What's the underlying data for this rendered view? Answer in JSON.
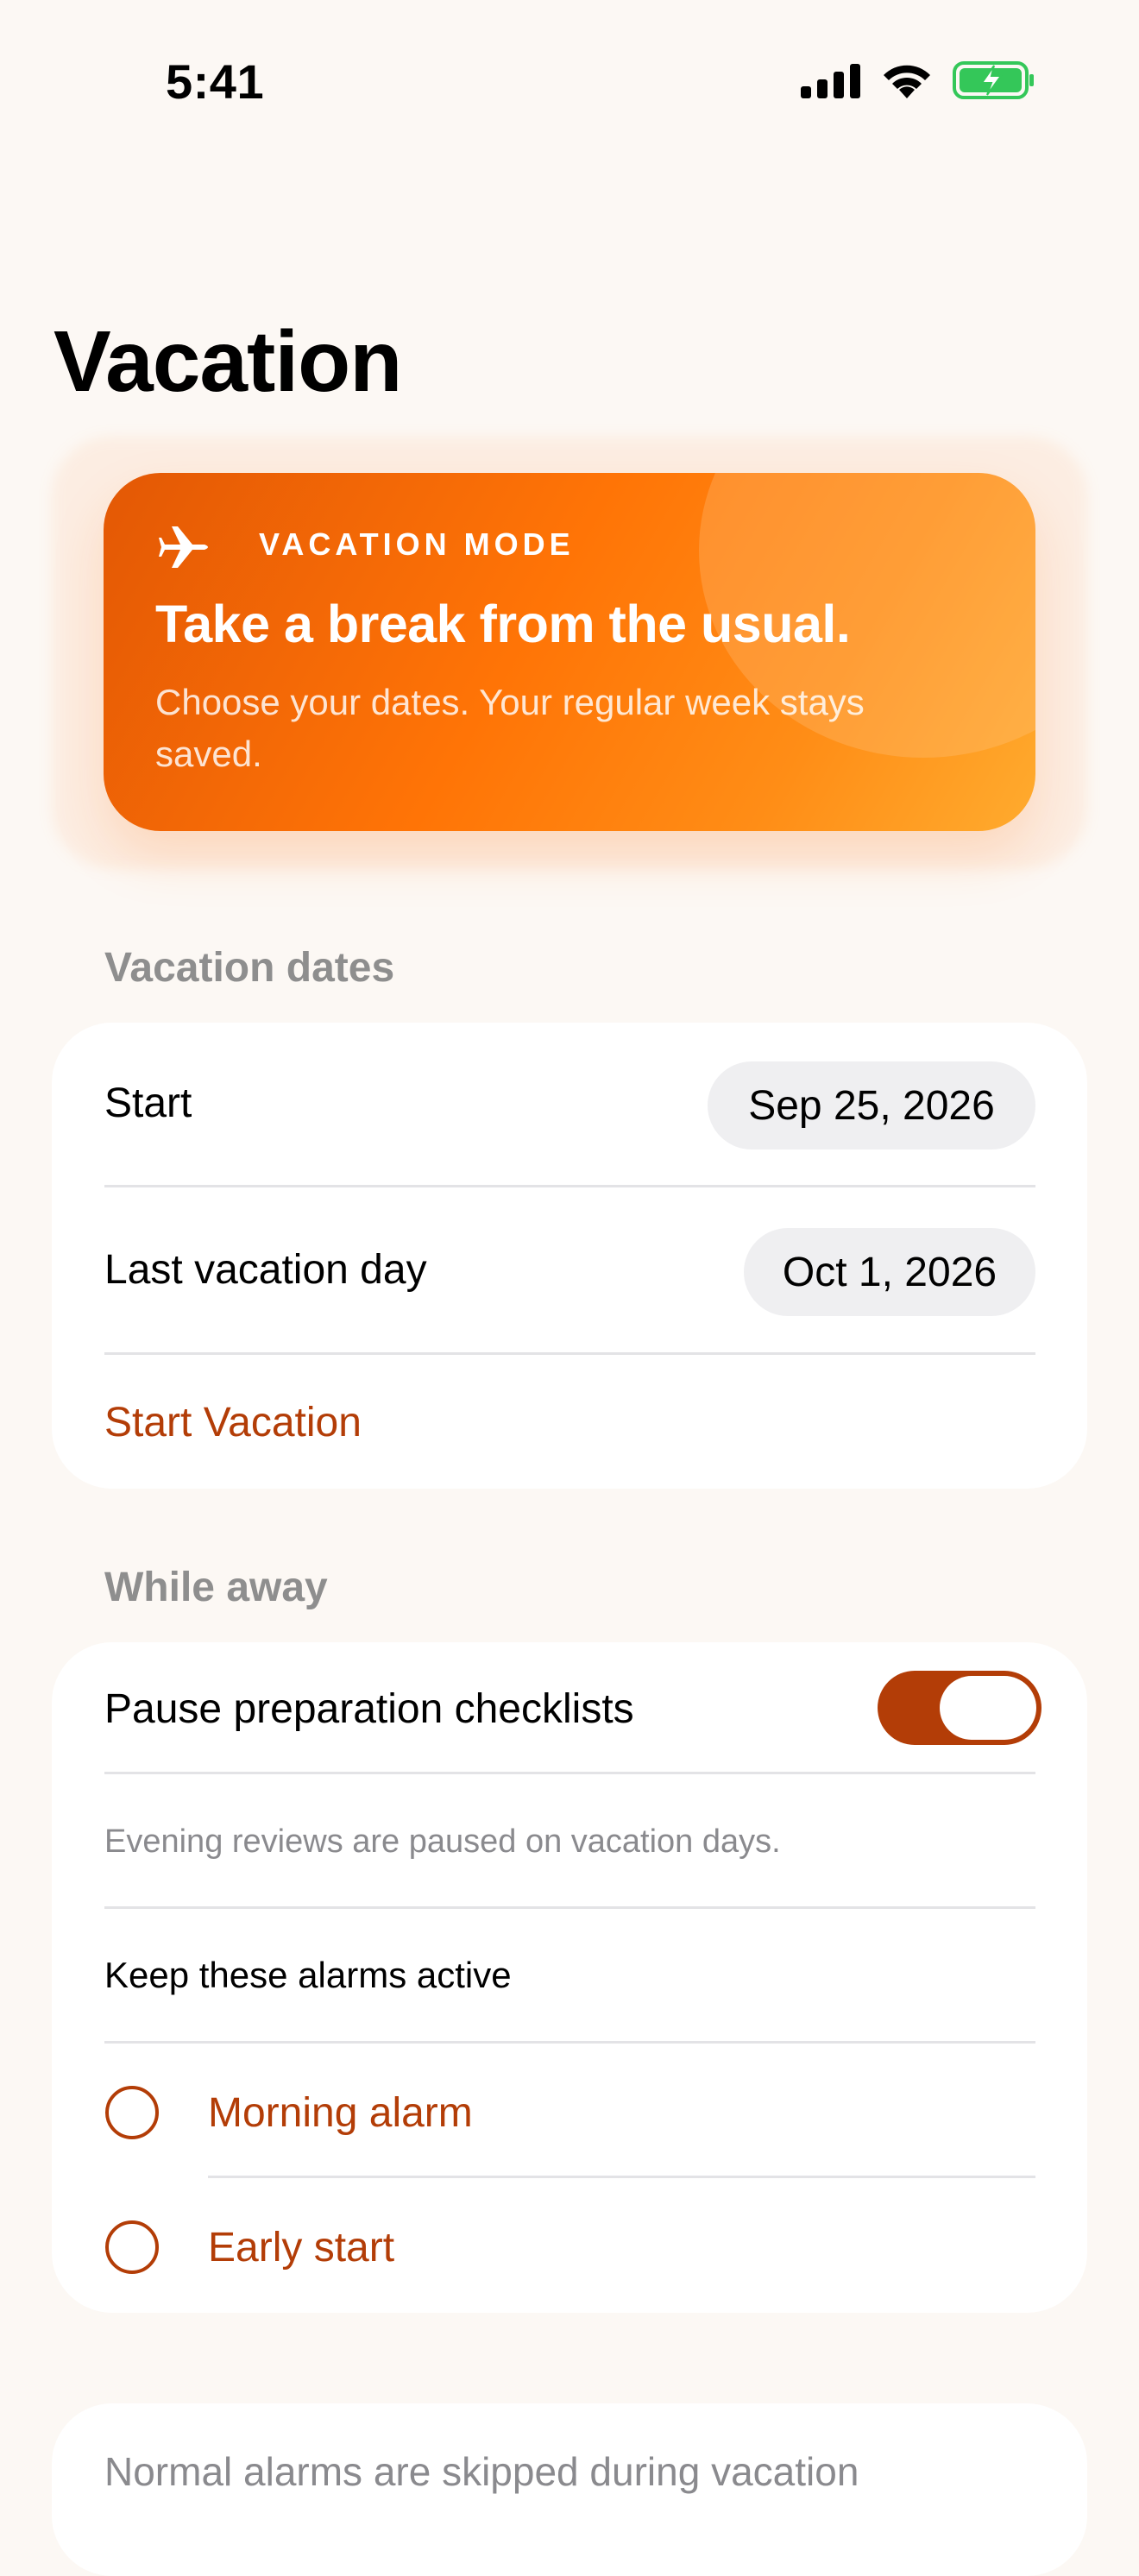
{
  "status_bar": {
    "time": "5:41"
  },
  "title": "Vacation",
  "hero": {
    "eyebrow": "VACATION MODE",
    "headline": "Take a break from the usual.",
    "subtitle": "Choose your dates. Your regular week stays saved."
  },
  "dates_section": {
    "header": "Vacation dates",
    "start_label": "Start",
    "start_value": "Sep 25, 2026",
    "end_label": "Last vacation day",
    "end_value": "Oct 1, 2026",
    "action": "Start Vacation"
  },
  "away_section": {
    "header": "While away",
    "pause_label": "Pause preparation checklists",
    "pause_on": true,
    "note": "Evening reviews are paused on vacation days.",
    "alarms_header": "Keep these alarms active",
    "alarms": [
      {
        "label": "Morning alarm",
        "selected": false
      },
      {
        "label": "Early start",
        "selected": false
      }
    ]
  },
  "footer_note": "Normal alarms are skipped during vacation",
  "colors": {
    "accent": "#b33d07",
    "hero_start": "#e35805",
    "hero_end": "#ffab2e",
    "background": "#fcf8f4"
  }
}
